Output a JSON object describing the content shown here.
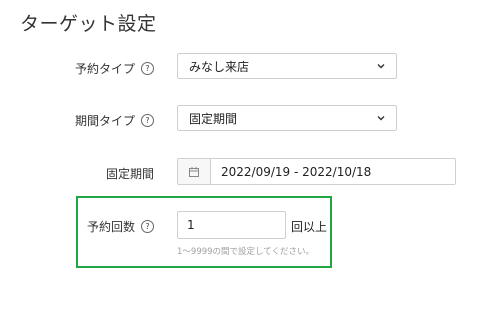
{
  "section": {
    "title": "ターゲット設定"
  },
  "reservation_type": {
    "label": "予約タイプ",
    "help_icon": "question-circle-icon",
    "selected": "みなし来店"
  },
  "period_type": {
    "label": "期間タイプ",
    "help_icon": "question-circle-icon",
    "selected": "固定期間"
  },
  "fixed_period": {
    "label": "固定期間",
    "icon": "calendar-icon",
    "value": "2022/09/19 - 2022/10/18"
  },
  "reservation_count": {
    "label": "予約回数",
    "help_icon": "question-circle-icon",
    "value": "1",
    "suffix": "回以上",
    "hint": "1〜9999の間で設定してください。"
  },
  "colors": {
    "highlight": "#21a646",
    "border": "#cfcfcf",
    "hint_text": "#a0a0a0"
  }
}
